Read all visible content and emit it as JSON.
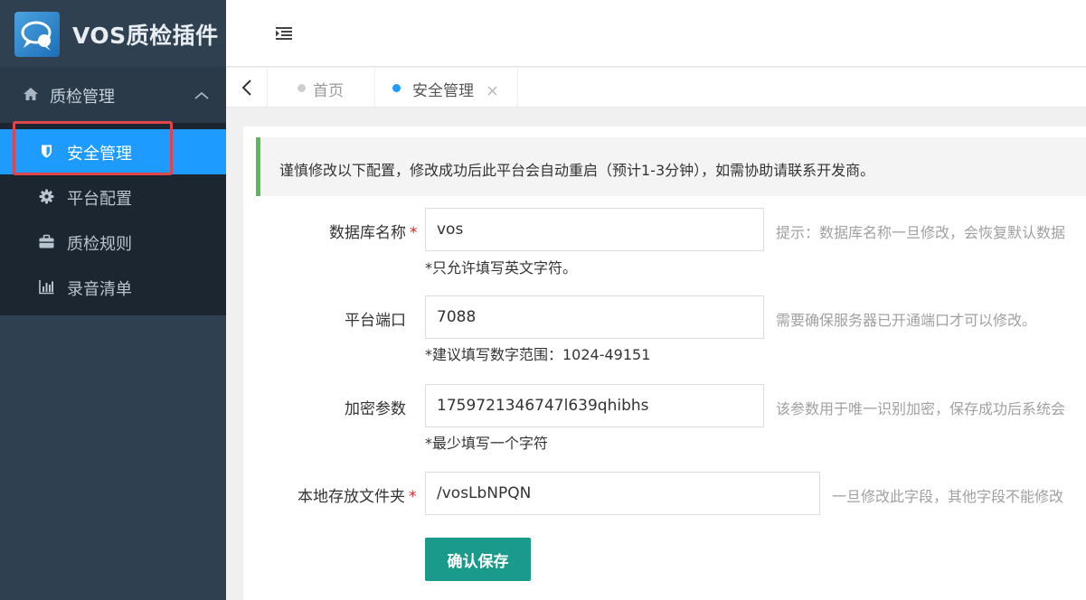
{
  "app": {
    "brand_title": "VOS质检插件"
  },
  "sidebar": {
    "group_label": "质检管理",
    "items": [
      {
        "label": "安全管理",
        "icon": "shield-icon",
        "active": true
      },
      {
        "label": "平台配置",
        "icon": "gear-icon",
        "active": false
      },
      {
        "label": "质检规则",
        "icon": "briefcase-icon",
        "active": false
      },
      {
        "label": "录音清单",
        "icon": "bar-chart-icon",
        "active": false
      }
    ]
  },
  "tabs": [
    {
      "label": "首页",
      "active": false
    },
    {
      "label": "安全管理",
      "active": true
    }
  ],
  "notice": {
    "text": "谨慎修改以下配置，修改成功后此平台会自动重启（预计1-3分钟），如需协助请联系开发商。"
  },
  "form": {
    "fields": [
      {
        "label": "数据库名称",
        "required": "*",
        "value": "vos",
        "hint": "提示：数据库名称一旦修改，会恢复默认数据",
        "note": "*只允许填写英文字符。"
      },
      {
        "label": "平台端口",
        "value": "7088",
        "hint": "需要确保服务器已开通端口才可以修改。",
        "note": "*建议填写数字范围：1024-49151"
      },
      {
        "label": "加密参数",
        "value": "1759721346747l639qhibhs",
        "hint": "该参数用于唯一识别加密，保存成功后系统会",
        "note": "*最少填写一个字符"
      },
      {
        "label": "本地存放文件夹",
        "required": "*",
        "value": "/vosLbNPQN",
        "hint": "一旦修改此字段，其他字段不能修改"
      }
    ],
    "save_label": "确认保存"
  },
  "colors": {
    "sidebar_bg": "#2f4050",
    "submenu_bg": "#1c2630",
    "active_item": "#1e9bff",
    "highlight_border": "#e0454b",
    "notice_border": "#5cb85c",
    "save_button": "#1a9a8a",
    "required_mark": "#e02020"
  }
}
